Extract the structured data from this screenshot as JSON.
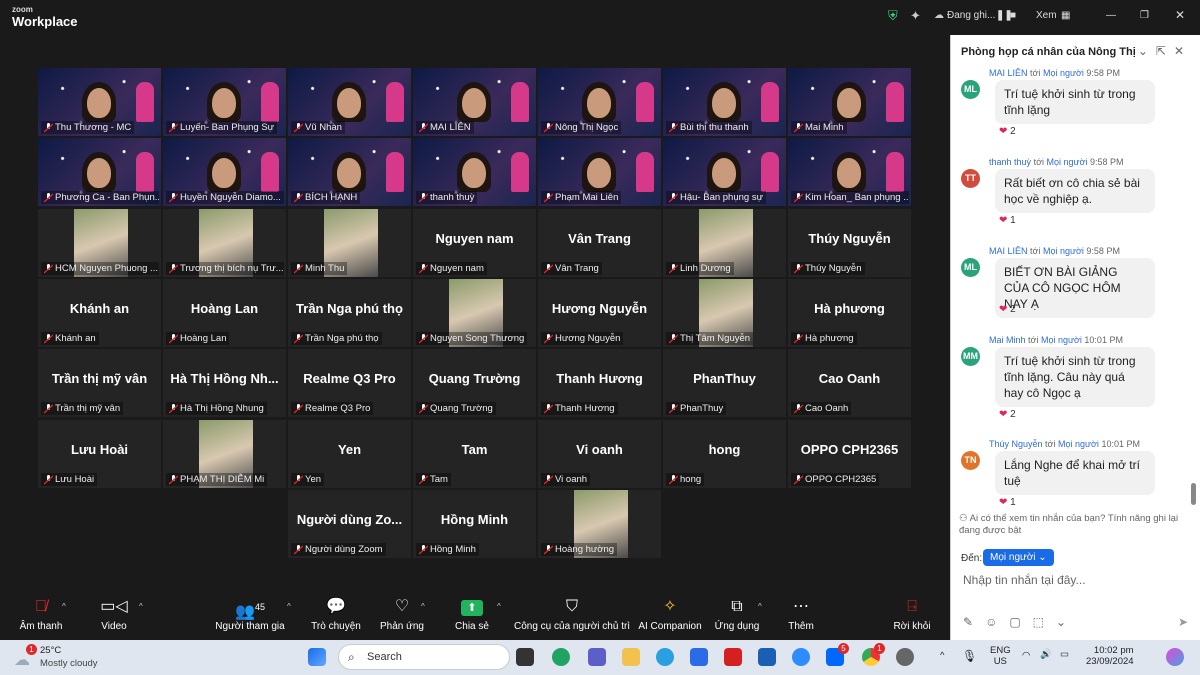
{
  "app": {
    "logo_top": "zoom",
    "logo_bottom": "Workplace",
    "recording": "Đang ghi...",
    "view": "Xem"
  },
  "tiles": [
    {
      "name": "Thu Thương - MC",
      "label": "",
      "type": "video"
    },
    {
      "name": "Luyến- Ban Phụng Sự",
      "label": "",
      "type": "video"
    },
    {
      "name": "Vũ Nhàn",
      "label": "",
      "type": "video"
    },
    {
      "name": "MAI LIÊN",
      "label": "",
      "type": "video"
    },
    {
      "name": "Nông Thị Ngọc",
      "label": "",
      "type": "video"
    },
    {
      "name": "Bùi thị thu thanh",
      "label": "",
      "type": "video"
    },
    {
      "name": "Mai Minh",
      "label": "",
      "type": "video"
    },
    {
      "name": "Phương Ca - Ban Phụn...",
      "label": "",
      "type": "video"
    },
    {
      "name": "Huyền Nguyễn Diamo...",
      "label": "",
      "type": "video"
    },
    {
      "name": "BÍCH HẠNH",
      "label": "",
      "type": "video"
    },
    {
      "name": "thanh thuỳ",
      "label": "",
      "type": "video"
    },
    {
      "name": "Phạm Mai Liên",
      "label": "",
      "type": "video"
    },
    {
      "name": "Hậu- Ban phụng sự",
      "label": "",
      "type": "video"
    },
    {
      "name": "Kim Hoan_ Ban phụng ...",
      "label": "",
      "type": "video"
    },
    {
      "name": "HCM Nguyen Phuong ...",
      "label": "",
      "type": "photo"
    },
    {
      "name": "Trương thị bích nụ Trư...",
      "label": "",
      "type": "photo"
    },
    {
      "name": "Minh Thu",
      "label": "",
      "type": "photo"
    },
    {
      "name": "Nguyen nam",
      "label": "Nguyen nam",
      "type": "name"
    },
    {
      "name": "Vân Trang",
      "label": "Vân Trang",
      "type": "name"
    },
    {
      "name": "Linh Dương",
      "label": "",
      "type": "photo"
    },
    {
      "name": "Thúy Nguyễn",
      "label": "Thúy Nguyễn",
      "type": "name"
    },
    {
      "name": "Khánh an",
      "label": "Khánh an",
      "type": "name"
    },
    {
      "name": "Hoàng Lan",
      "label": "Hoàng Lan",
      "type": "name"
    },
    {
      "name": "Trần Nga phú thọ",
      "label": "Trần Nga phú thọ",
      "type": "name"
    },
    {
      "name": "Nguyen Song Thương",
      "label": "",
      "type": "photo"
    },
    {
      "name": "Hương Nguyễn",
      "label": "Hương Nguyễn",
      "type": "name"
    },
    {
      "name": "Thị Tâm Nguyễn",
      "label": "",
      "type": "photo"
    },
    {
      "name": "Hà phương",
      "label": "Hà phương",
      "type": "name"
    },
    {
      "name": "Trần thị mỹ vân",
      "label": "Trần thị mỹ vân",
      "type": "name"
    },
    {
      "name": "Hà Thị Hồng Nhung",
      "label": "Hà Thị Hồng Nh...",
      "type": "name"
    },
    {
      "name": "Realme Q3 Pro",
      "label": "Realme Q3 Pro",
      "type": "name"
    },
    {
      "name": "Quang Trường",
      "label": "Quang Trường",
      "type": "name"
    },
    {
      "name": "Thanh Hương",
      "label": "Thanh Hương",
      "type": "name"
    },
    {
      "name": "PhanThuy",
      "label": "PhanThuy",
      "type": "name"
    },
    {
      "name": "Cao Oanh",
      "label": "Cao Oanh",
      "type": "name"
    },
    {
      "name": "Lưu Hoài",
      "label": "Lưu Hoài",
      "type": "name"
    },
    {
      "name": "PHẠM THỊ DIỄM Mi",
      "label": "",
      "type": "photo"
    },
    {
      "name": "Yen",
      "label": "Yen",
      "type": "name"
    },
    {
      "name": "Tam",
      "label": "Tam",
      "type": "name"
    },
    {
      "name": "Vi oanh",
      "label": "Vi oanh",
      "type": "name"
    },
    {
      "name": "hong",
      "label": "hong",
      "type": "name"
    },
    {
      "name": "OPPO CPH2365",
      "label": "OPPO CPH2365",
      "type": "name"
    },
    {
      "name": "Người dùng Zoom",
      "label": "Người dùng Zo...",
      "type": "name"
    },
    {
      "name": "Hồng Minh",
      "label": "Hồng Minh",
      "type": "name"
    },
    {
      "name": "Hoàng hường",
      "label": "",
      "type": "photo"
    }
  ],
  "toolbar": {
    "audio": "Âm thanh",
    "video": "Video",
    "participants": "Người tham gia",
    "participants_count": "45",
    "chat": "Trò chuyện",
    "reactions": "Phản ứng",
    "share": "Chia sẻ",
    "host_tools": "Công cụ của người chủ trì",
    "ai": "AI Companion",
    "apps": "Ứng dụng",
    "more": "Thêm",
    "leave": "Rời khỏi"
  },
  "chat": {
    "title": "Phòng họp cá nhân của Nông Thị ...",
    "to_word": "tới",
    "everyone": "Mọi người",
    "messages": [
      {
        "initials": "ML",
        "sender": "MAI LIÊN",
        "time": "9:58 PM",
        "text": "Trí tuệ khởi sinh từ trong tĩnh lặng",
        "reactions": "2",
        "color": "#2aa37a"
      },
      {
        "initials": "TT",
        "sender": "thanh thuỳ",
        "time": "9:58 PM",
        "text": "Rất biết ơn cô chia sẻ bài học về nghiệp ạ.",
        "reactions": "1",
        "color": "#d24b3c"
      },
      {
        "initials": "ML",
        "sender": "MAI LIÊN",
        "time": "9:58 PM",
        "text": "BIẾT ƠN BÀI GIẢNG CỦA CÔ NGỌC HÔM NAY Ạ",
        "reactions": "2",
        "color": "#2aa37a"
      },
      {
        "initials": "MM",
        "sender": "Mai Minh",
        "time": "10:01 PM",
        "text": "Trí tuệ khởi sinh từ trong tĩnh lặng. Câu này quá hay cô  Ngọc ạ",
        "reactions": "2",
        "color": "#2aa37a"
      },
      {
        "initials": "TN",
        "sender": "Thúy Nguyễn",
        "time": "10:01 PM",
        "text": "Lắng Nghe để khai mở trí tuệ",
        "reactions": "1",
        "color": "#e0752a"
      }
    ],
    "notice": "Ai có thể xem tin nhắn của bạn? Tính năng ghi lại đang được bật",
    "to_label": "Đến:",
    "to_value": "Mọi người",
    "placeholder": "Nhập tin nhắn tại đây..."
  },
  "taskbar": {
    "temp": "25°C",
    "weather": "Mostly cloudy",
    "weather_badge": "1",
    "search": "Search",
    "lang1": "ENG",
    "lang2": "US",
    "time": "10:02 pm",
    "date": "23/09/2024",
    "zalo_badge": "5",
    "chrome_badge": "1"
  },
  "colors": {
    "accent": "#1a6be8",
    "active_speaker": "#3dd28a",
    "leave": "#e02828"
  }
}
